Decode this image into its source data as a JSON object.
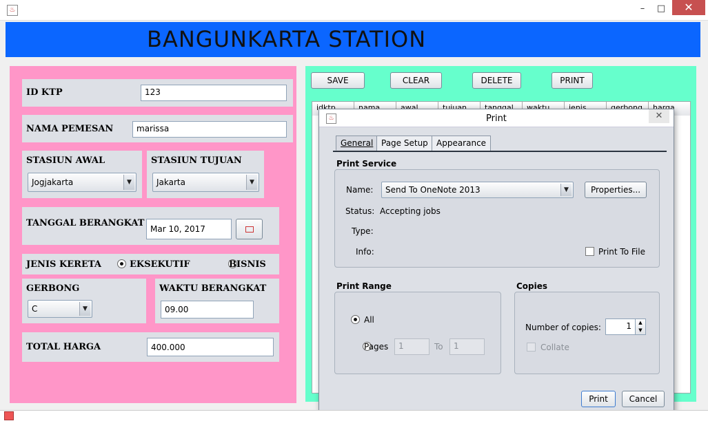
{
  "window": {
    "minimize": "–",
    "maximize": "□",
    "close": "✕"
  },
  "header": {
    "title": "BANGUNKARTA STATION"
  },
  "form": {
    "id_ktp_label": "ID KTP",
    "id_ktp_value": "123",
    "nama_label": "NAMA PEMESAN",
    "nama_value": "marissa",
    "stasiun_awal_label": "STASIUN AWAL",
    "stasiun_awal_value": "Jogjakarta",
    "stasiun_tujuan_label": "STASIUN TUJUAN",
    "stasiun_tujuan_value": "Jakarta",
    "tanggal_label": "TANGGAL BERANGKAT",
    "tanggal_value": "Mar 10, 2017",
    "jenis_label": "JENIS KERETA",
    "jenis_opt1": "EKSEKUTIF",
    "jenis_opt2": "BISNIS",
    "gerbong_label": "GERBONG",
    "gerbong_value": "C",
    "waktu_label": "WAKTU BERANGKAT",
    "waktu_value": "09.00",
    "total_label": "TOTAL HARGA",
    "total_value": "400.000"
  },
  "actions": {
    "save": "SAVE",
    "clear": "CLEAR",
    "delete": "DELETE",
    "print": "PRINT"
  },
  "table": {
    "columns": [
      "idktp",
      "nama",
      "awal",
      "tujuan",
      "tanggal",
      "waktu",
      "jenis",
      "gerbong",
      "harga"
    ]
  },
  "print_dialog": {
    "title": "Print",
    "tabs": [
      "General",
      "Page Setup",
      "Appearance"
    ],
    "service_title": "Print Service",
    "name_label": "Name:",
    "printer": "Send To OneNote 2013",
    "properties": "Properties...",
    "status_label": "Status:",
    "status_value": "Accepting jobs",
    "type_label": "Type:",
    "info_label": "Info:",
    "print_to_file": "Print To File",
    "range_title": "Print Range",
    "all": "All",
    "pages": "Pages",
    "pages_from": "1",
    "to": "To",
    "pages_to": "1",
    "copies_title": "Copies",
    "num_copies_label": "Number of copies:",
    "num_copies": "1",
    "collate": "Collate",
    "print_btn": "Print",
    "cancel_btn": "Cancel"
  }
}
